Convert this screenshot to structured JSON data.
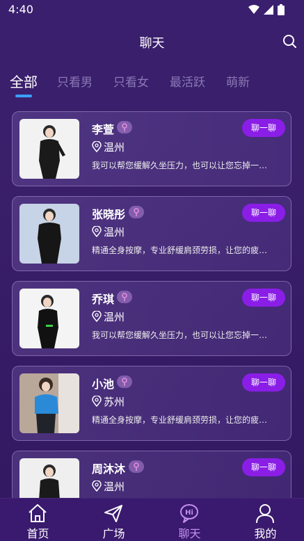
{
  "status_bar": {
    "time": "4:40"
  },
  "header": {
    "title": "聊天"
  },
  "tabs": [
    {
      "label": "全部"
    },
    {
      "label": "只看男"
    },
    {
      "label": "只看女"
    },
    {
      "label": "最活跃"
    },
    {
      "label": "萌新"
    }
  ],
  "users": [
    {
      "name": "李萱",
      "location": "温州",
      "desc": "我可以帮您缓解久坐压力，也可以让您忘掉一…",
      "chat_label": "聊一聊"
    },
    {
      "name": "张晓彤",
      "location": "温州",
      "desc": "精通全身按摩，专业舒缓肩颈劳损，让您的疲…",
      "chat_label": "聊一聊"
    },
    {
      "name": "乔琪",
      "location": "温州",
      "desc": "我可以帮您缓解久坐压力，也可以让您忘掉一…",
      "chat_label": "聊一聊"
    },
    {
      "name": "小池",
      "location": "苏州",
      "desc": "精通全身按摩，专业舒缓肩颈劳损，让您的疲…",
      "chat_label": "聊一聊"
    },
    {
      "name": "周沐沐",
      "location": "温州",
      "desc": "",
      "chat_label": "聊一聊"
    }
  ],
  "bottom_nav": [
    {
      "label": "首页",
      "icon": "home-icon"
    },
    {
      "label": "广场",
      "icon": "send-icon"
    },
    {
      "label": "聊天",
      "icon": "chat-hi-icon"
    },
    {
      "label": "我的",
      "icon": "user-icon"
    }
  ],
  "colors": {
    "accent": "#8a1ee6",
    "tab_indicator": "#3aa0ff",
    "active_nav": "#c38ff0"
  }
}
